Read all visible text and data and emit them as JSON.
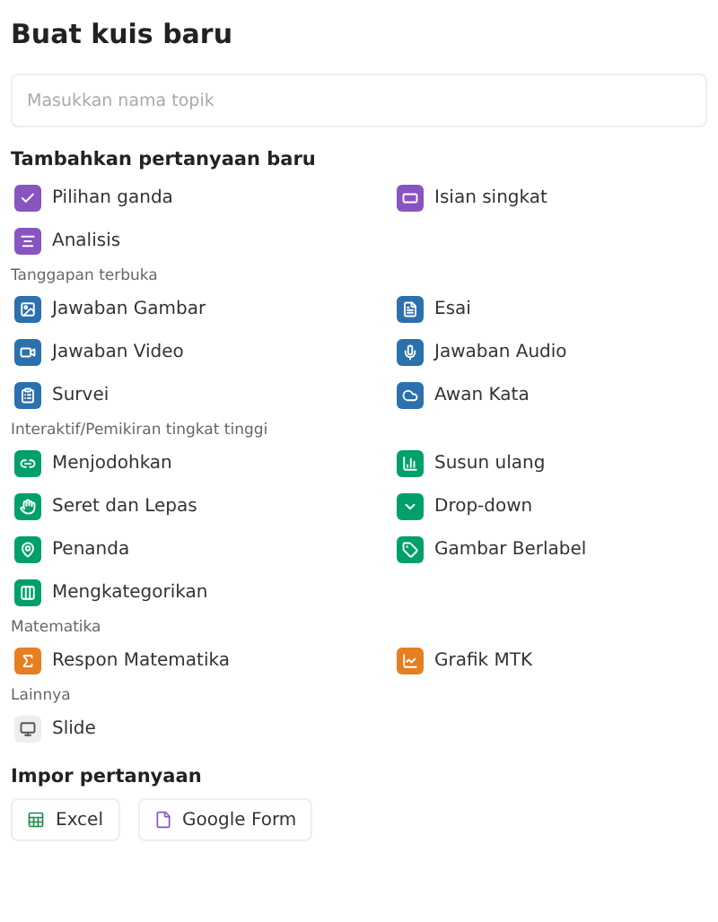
{
  "title": "Buat kuis baru",
  "topic_field": {
    "placeholder": "Masukkan nama topik"
  },
  "add_heading": "Tambahkan pertanyaan baru",
  "groups": [
    {
      "color": "#8854c0",
      "items": [
        "Pilihan ganda",
        "Isian singkat",
        "Analisis"
      ]
    },
    {
      "heading": "Tanggapan terbuka",
      "color": "#2d70ae",
      "items": [
        "Jawaban Gambar",
        "Esai",
        "Jawaban Video",
        "Jawaban Audio",
        "Survei",
        "Awan Kata"
      ]
    },
    {
      "heading": "Interaktif/Pemikiran tingkat tinggi",
      "color": "#00a06a",
      "items": [
        "Menjodohkan",
        "Susun ulang",
        "Seret dan Lepas",
        "Drop-down",
        "Penanda",
        "Gambar Berlabel",
        "Mengkategorikan"
      ]
    },
    {
      "heading": "Matematika",
      "color": "#e67e22",
      "items": [
        "Respon Matematika",
        "Grafik MTK"
      ]
    },
    {
      "heading": "Lainnya",
      "color": "#eeeeee",
      "items": [
        "Slide"
      ]
    }
  ],
  "import_heading": "Impor pertanyaan",
  "import_buttons": [
    "Excel",
    "Google Form"
  ]
}
